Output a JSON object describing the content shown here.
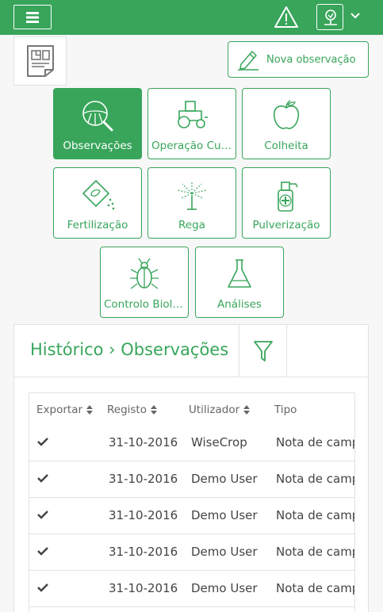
{
  "colors": {
    "brand": "#38a55b",
    "header_bg": "#38a55b",
    "panel_border": "#e2e2e2"
  },
  "header": {
    "menu_icon": "hamburger-icon",
    "alert_icon": "warning-icon",
    "farm_icon": "farm-tree-icon",
    "dropdown_icon": "chevron-down-icon"
  },
  "report_icon": "report-document-icon",
  "new_observation": {
    "label": "Nova observação",
    "icon": "pencil-icon"
  },
  "categories": [
    {
      "label": "Observações",
      "icon": "magnifier-field-icon",
      "active": true
    },
    {
      "label": "Operação Cultural",
      "icon": "tractor-icon",
      "active": false
    },
    {
      "label": "Colheita",
      "icon": "apple-icon",
      "active": false
    },
    {
      "label": "Fertilização",
      "icon": "fertilizer-bag-icon",
      "active": false
    },
    {
      "label": "Rega",
      "icon": "sprinkler-icon",
      "active": false
    },
    {
      "label": "Pulverização",
      "icon": "spray-bottle-icon",
      "active": false
    },
    {
      "label": "Controlo Biológico",
      "icon": "bug-icon",
      "active": false
    },
    {
      "label": "Análises",
      "icon": "flask-icon",
      "active": false
    }
  ],
  "history": {
    "title": "Histórico › Observações",
    "filter_icon": "filter-icon",
    "columns": [
      "Exportar",
      "Registo",
      "Utilizador",
      "Tipo"
    ],
    "rows": [
      {
        "date": "31-10-2016",
        "user": "WiseCrop",
        "type": "Nota de campo"
      },
      {
        "date": "31-10-2016",
        "user": "Demo User",
        "type": "Nota de campo"
      },
      {
        "date": "31-10-2016",
        "user": "Demo User",
        "type": "Nota de campo"
      },
      {
        "date": "31-10-2016",
        "user": "Demo User",
        "type": "Nota de campo"
      },
      {
        "date": "31-10-2016",
        "user": "Demo User",
        "type": "Nota de campo"
      }
    ]
  }
}
